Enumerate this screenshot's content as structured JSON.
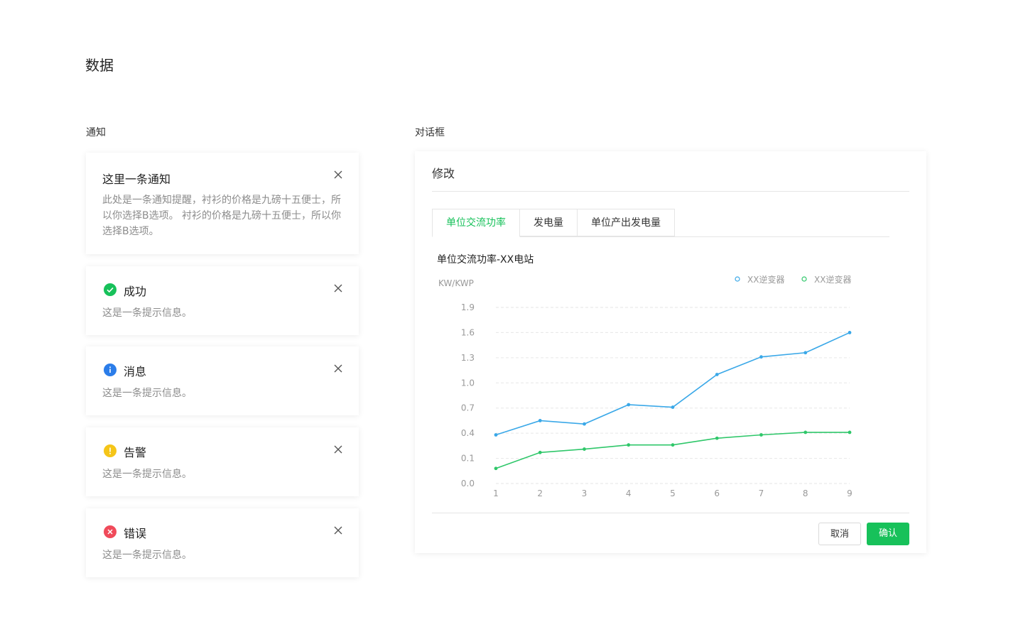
{
  "page": {
    "title": "数据"
  },
  "sections": {
    "notice_title": "通知",
    "dialog_title": "对话框"
  },
  "notices": [
    {
      "title": "这里一条通知",
      "desc": "此处是一条通知提醒，衬衫的价格是九磅十五便士，所以你选择B选项。 衬衫的价格是九磅十五便士，所以你选择B选项。",
      "icon": null
    },
    {
      "title": "成功",
      "desc": "这是一条提示信息。",
      "icon": "success-check-icon",
      "color": "#17c15a"
    },
    {
      "title": "消息",
      "desc": "这是一条提示信息。",
      "icon": "info-icon",
      "color": "#2b7de9"
    },
    {
      "title": "告警",
      "desc": "这是一条提示信息。",
      "icon": "warning-icon",
      "color": "#f5c518"
    },
    {
      "title": "错误",
      "desc": "这是一条提示信息。",
      "icon": "error-icon",
      "color": "#f04a5a"
    }
  ],
  "dialog": {
    "title": "修改",
    "tabs": [
      "单位交流功率",
      "发电量",
      "单位产出发电量"
    ],
    "active_tab": 0,
    "cancel_label": "取消",
    "confirm_label": "确认"
  },
  "chart_data": {
    "type": "line",
    "title": "单位交流功率-XX电站",
    "ylabel": "KW/KWP",
    "xlabel": "",
    "x": [
      1,
      2,
      3,
      4,
      5,
      6,
      7,
      8,
      9
    ],
    "y_ticks": [
      "0.0",
      "0.1",
      "0.4",
      "0.7",
      "1.0",
      "1.3",
      "1.6",
      "1.9"
    ],
    "ylim": [
      0.0,
      1.9
    ],
    "grid": true,
    "legend_position": "top-right",
    "series": [
      {
        "name": "XX逆变器",
        "color": "#3aa8e8",
        "values": [
          0.38,
          0.55,
          0.51,
          0.74,
          0.71,
          1.1,
          1.31,
          1.36,
          1.6
        ]
      },
      {
        "name": "XX逆变器",
        "color": "#2fc76a",
        "values": [
          0.06,
          0.17,
          0.21,
          0.26,
          0.26,
          0.34,
          0.38,
          0.41,
          0.41
        ]
      }
    ]
  },
  "colors": {
    "accent": "#17c15a",
    "grid": "#e6e6e6",
    "axis_text": "#999999"
  }
}
